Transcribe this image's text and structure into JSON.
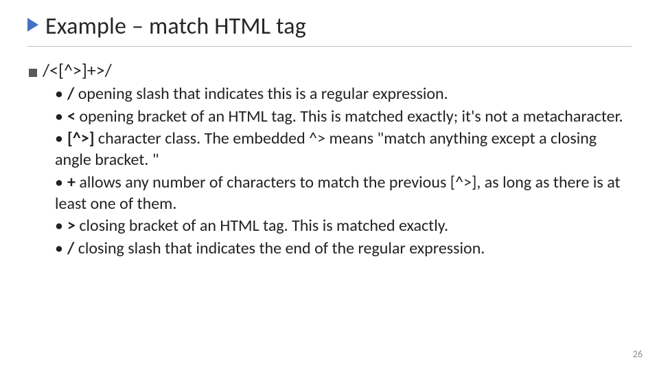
{
  "title": "Example – match HTML tag",
  "main_bullet": "/<[^>]+>/",
  "items": [
    {
      "symbol": "/",
      "desc": "   opening slash that indicates this is a regular expression."
    },
    {
      "symbol": "<",
      "desc": "   opening bracket of an HTML tag. This is matched exactly; it's not a metacharacter."
    },
    {
      "symbol": "[^>]",
      "desc": "   character class. The embedded ^> means \"match anything except a closing angle bracket. \""
    },
    {
      "symbol": "+",
      "desc": "   allows any number of characters to match the previous [^>], as long as there is at least one of them."
    },
    {
      "symbol": ">",
      "desc": "    closing bracket of an HTML tag. This is matched exactly."
    },
    {
      "symbol": "/",
      "desc": "    closing slash that indicates the end of the regular expression."
    }
  ],
  "page_number": "26"
}
